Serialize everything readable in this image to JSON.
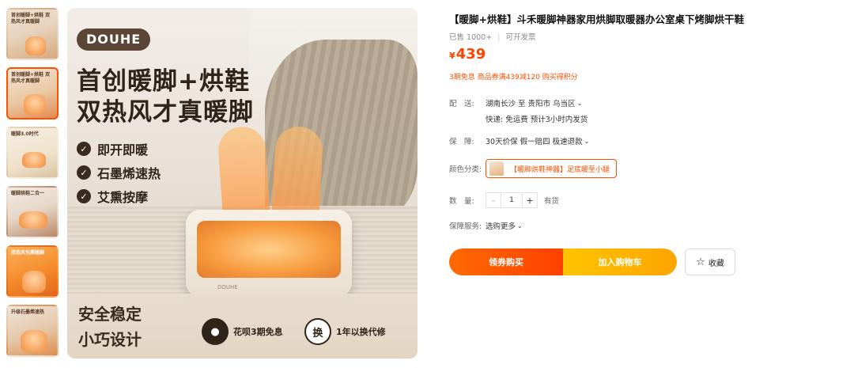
{
  "thumbnails": [
    {
      "label": "首创暖脚+烘鞋 双热风才真暖脚"
    },
    {
      "label": "首创暖脚+烘鞋 双热风才真暖脚"
    },
    {
      "label": "暖脚3.0时代"
    },
    {
      "label": "暖脚烘鞋二合一"
    },
    {
      "label": "双热风包裹暖脚"
    },
    {
      "label": "升级石墨烯速热"
    }
  ],
  "main_image": {
    "brand_logo": "DOUHE",
    "headline_1": "首创暖脚+烘鞋",
    "headline_2": "双热风才真暖脚",
    "features": [
      "即开即暖",
      "石墨烯速热",
      "艾熏按摩"
    ],
    "bottom_1": "安全稳定",
    "bottom_2": "小巧设计",
    "badge_1": "花呗3期免息",
    "badge_1_icon": "●",
    "badge_2": "1年以换代修",
    "badge_2_icon": "换",
    "device_brand": "DOUHE"
  },
  "product": {
    "title": "【暖脚+烘鞋】斗禾暖脚神器家用烘脚取暖器办公室桌下烤脚烘干鞋",
    "sold": "已售 1000+",
    "invoice": "可开发票",
    "currency": "¥",
    "price": "439",
    "promo": "3期免息 商品券满439减120 购买得积分"
  },
  "shipping": {
    "label": "配　送:",
    "route": "湖南长沙  至  贵阳市 乌当区",
    "detail": "快递: 免运费  预计3小时内发货"
  },
  "guarantee": {
    "label": "保　障:",
    "value": "30天价保 假一赔四 极速退款"
  },
  "color": {
    "label": "颜色分类:",
    "selected": "【暖脚烘鞋神器】足底暖至小腿"
  },
  "quantity": {
    "label": "数　量:",
    "minus": "-",
    "value": "1",
    "plus": "+",
    "stock": "有货"
  },
  "service": {
    "label": "保障服务:",
    "value": "选购更多"
  },
  "actions": {
    "buy": "领券购买",
    "cart": "加入购物车",
    "favorite": "收藏"
  },
  "colors": {
    "accent": "#ff5000",
    "price": "#ff4400",
    "buy_start": "#ff6a00",
    "cart_start": "#ffc400"
  }
}
